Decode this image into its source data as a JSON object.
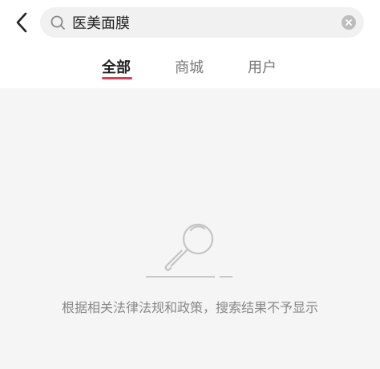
{
  "header": {
    "back_icon": "chevron-left-icon",
    "search_query": "医美面膜",
    "search_icon": "search-icon",
    "clear_icon": "clear-icon"
  },
  "tabs": [
    {
      "label": "全部",
      "active": true
    },
    {
      "label": "商城",
      "active": false
    },
    {
      "label": "用户",
      "active": false
    }
  ],
  "empty_state": {
    "illustration_icon": "magnifier-icon",
    "message": "根据相关法律法规和政策，搜索结果不予显示"
  },
  "colors": {
    "accent": "#e23b55",
    "content_bg": "#f5f5f5",
    "search_bg": "#f1f1f1"
  }
}
